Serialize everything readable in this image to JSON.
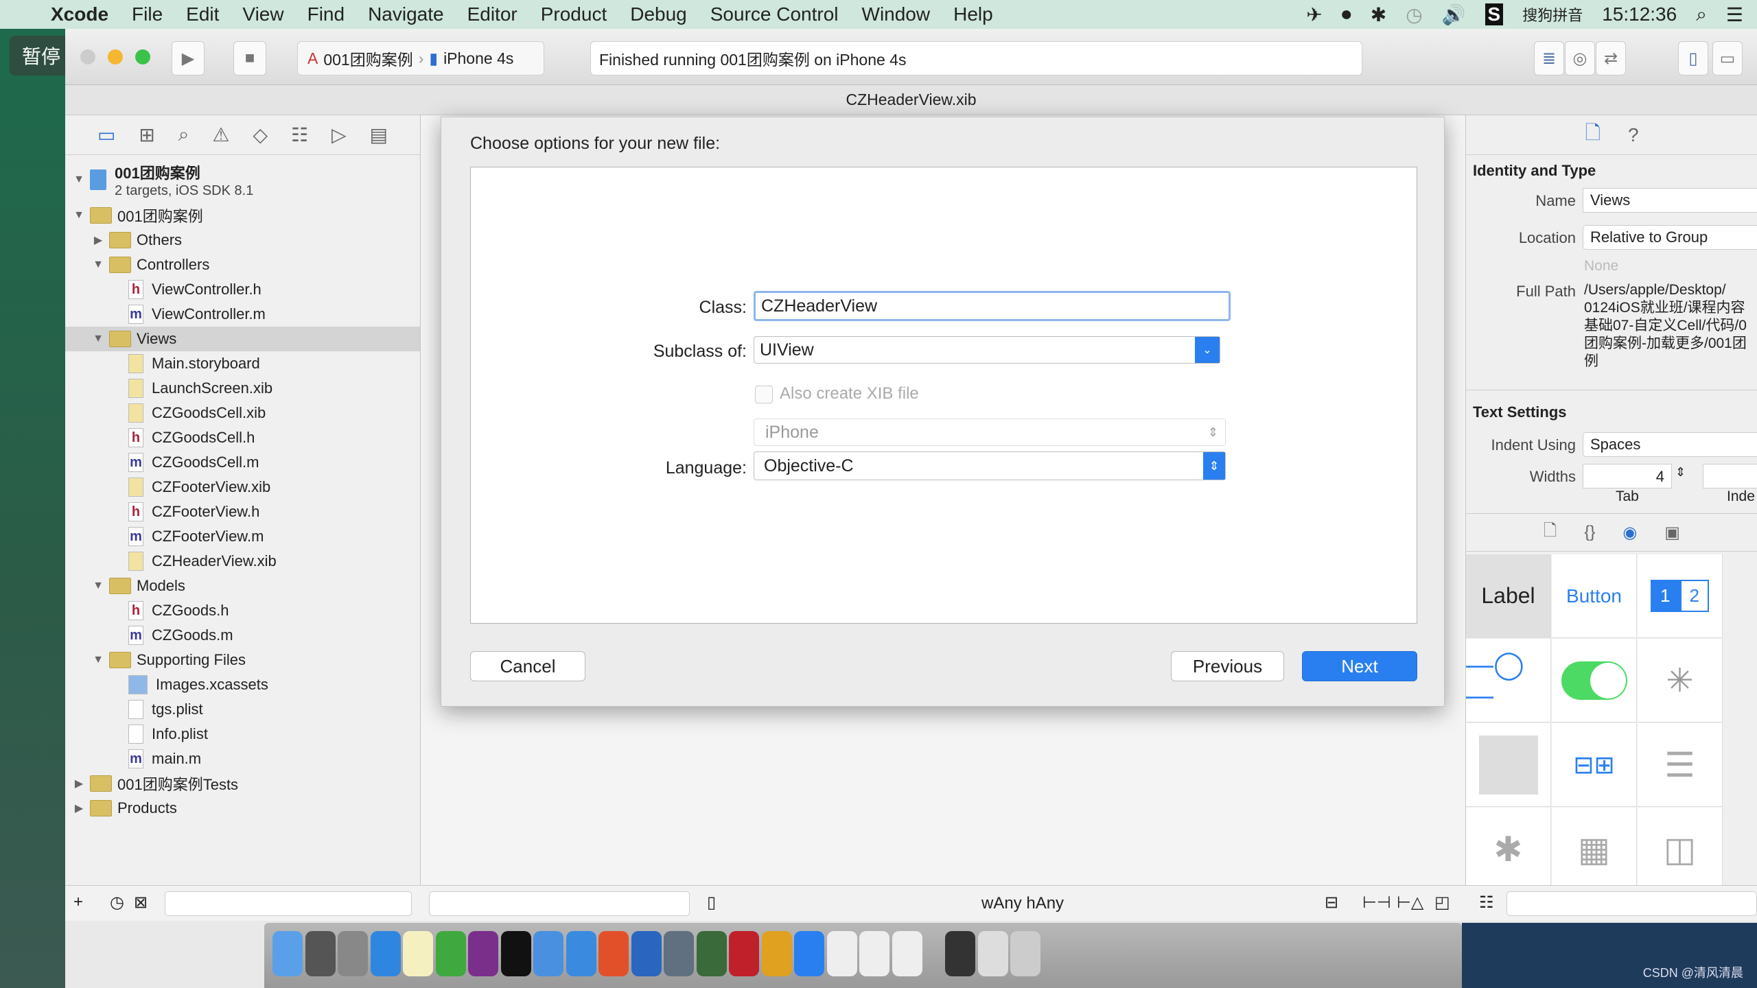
{
  "menubar": {
    "apple": "",
    "app": "Xcode",
    "items": [
      "File",
      "Edit",
      "View",
      "Find",
      "Navigate",
      "Editor",
      "Product",
      "Debug",
      "Source Control",
      "Window",
      "Help"
    ],
    "input_method": "搜狗拼音",
    "time": "15:12:36"
  },
  "overlay": {
    "pause_label": "暂停"
  },
  "toolbar": {
    "scheme": "001团购案例",
    "device": "iPhone 4s",
    "status": "Finished running 001团购案例 on iPhone 4s"
  },
  "window": {
    "title": "CZHeaderView.xib"
  },
  "navigator": {
    "project": {
      "name": "001团购案例",
      "subtitle": "2 targets, iOS SDK 8.1"
    },
    "items": [
      {
        "label": "001团购案例",
        "depth": 1,
        "type": "folder",
        "expanded": true
      },
      {
        "label": "Others",
        "depth": 2,
        "type": "folder",
        "expanded": false
      },
      {
        "label": "Controllers",
        "depth": 2,
        "type": "folder",
        "expanded": true
      },
      {
        "label": "ViewController.h",
        "depth": 3,
        "type": "h"
      },
      {
        "label": "ViewController.m",
        "depth": 3,
        "type": "m"
      },
      {
        "label": "Views",
        "depth": 2,
        "type": "folder",
        "expanded": true,
        "selected": true
      },
      {
        "label": "Main.storyboard",
        "depth": 3,
        "type": "ib"
      },
      {
        "label": "LaunchScreen.xib",
        "depth": 3,
        "type": "ib"
      },
      {
        "label": "CZGoodsCell.xib",
        "depth": 3,
        "type": "ib"
      },
      {
        "label": "CZGoodsCell.h",
        "depth": 3,
        "type": "h"
      },
      {
        "label": "CZGoodsCell.m",
        "depth": 3,
        "type": "m"
      },
      {
        "label": "CZFooterView.xib",
        "depth": 3,
        "type": "ib"
      },
      {
        "label": "CZFooterView.h",
        "depth": 3,
        "type": "h"
      },
      {
        "label": "CZFooterView.m",
        "depth": 3,
        "type": "m"
      },
      {
        "label": "CZHeaderView.xib",
        "depth": 3,
        "type": "ib"
      },
      {
        "label": "Models",
        "depth": 2,
        "type": "folder",
        "expanded": true
      },
      {
        "label": "CZGoods.h",
        "depth": 3,
        "type": "h"
      },
      {
        "label": "CZGoods.m",
        "depth": 3,
        "type": "m"
      },
      {
        "label": "Supporting Files",
        "depth": 2,
        "type": "folder",
        "expanded": true
      },
      {
        "label": "Images.xcassets",
        "depth": 3,
        "type": "assets"
      },
      {
        "label": "tgs.plist",
        "depth": 3,
        "type": "plist"
      },
      {
        "label": "Info.plist",
        "depth": 3,
        "type": "plist"
      },
      {
        "label": "main.m",
        "depth": 3,
        "type": "m"
      },
      {
        "label": "001团购案例Tests",
        "depth": 1,
        "type": "folder",
        "expanded": false
      },
      {
        "label": "Products",
        "depth": 1,
        "type": "folder",
        "expanded": false
      }
    ]
  },
  "dialog": {
    "title": "Choose options for your new file:",
    "class_label": "Class:",
    "class_value": "CZHeaderView",
    "subclass_label": "Subclass of:",
    "subclass_value": "UIView",
    "xib_checkbox_label": "Also create XIB file",
    "xib_checked": false,
    "device_value": "iPhone",
    "language_label": "Language:",
    "language_value": "Objective-C",
    "cancel": "Cancel",
    "previous": "Previous",
    "next": "Next",
    "accent": "#2a7ff0"
  },
  "inspector": {
    "identity_header": "Identity and Type",
    "name_label": "Name",
    "name_value": "Views",
    "location_label": "Location",
    "location_value": "Relative to Group",
    "location_none": "None",
    "fullpath_label": "Full Path",
    "fullpath_value": "/Users/apple/Desktop/ 0124iOS就业班/课程内容 基础07-自定义Cell/代码/0 团购案例-加载更多/001团 例",
    "text_header": "Text Settings",
    "indent_label": "Indent Using",
    "indent_value": "Spaces",
    "widths_label": "Widths",
    "tab_value": "4",
    "tab_label": "Tab",
    "indent_sub": "Inde",
    "library": {
      "label": "Label",
      "button": "Button",
      "seg1": "1",
      "seg2": "2"
    }
  },
  "bottombar": {
    "size_class": "wAny hAny"
  },
  "watermark": "CSDN @清风清晨"
}
